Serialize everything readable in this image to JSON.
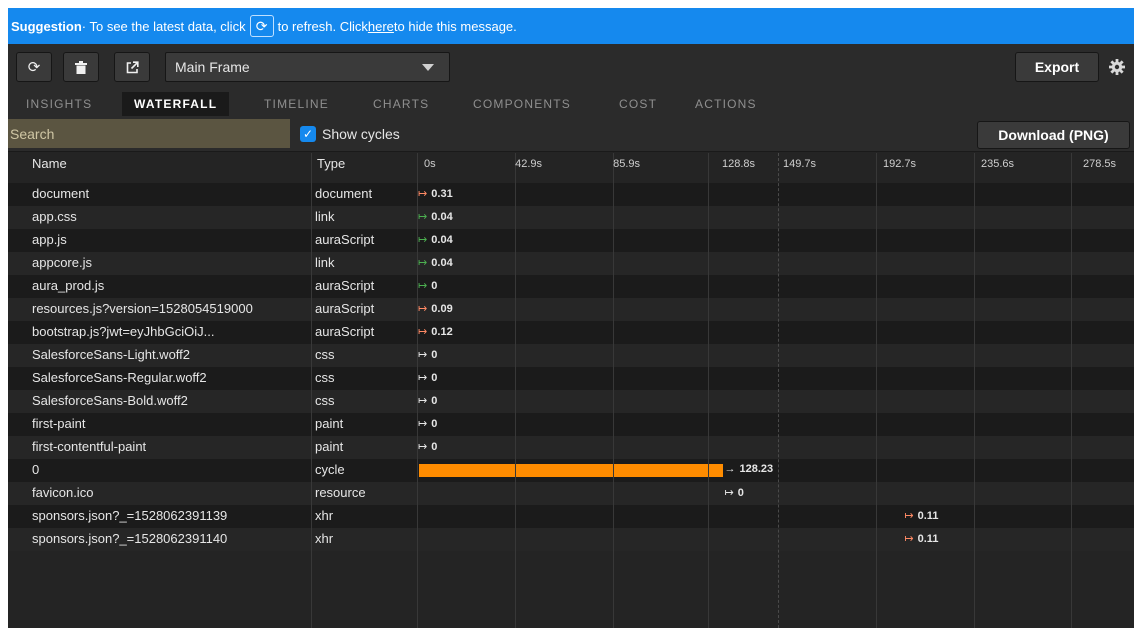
{
  "banner": {
    "title": "Suggestion",
    "text_before": " · To see the latest data, click ",
    "refresh_glyph": "⟳",
    "text_middle": " to refresh. Click ",
    "link_text": "here",
    "text_after": " to hide this message."
  },
  "toolbar": {
    "refresh_icon": "⟳",
    "trash_icon": "🗑",
    "popout_icon": "⧉",
    "frame_select_value": "Main Frame",
    "export_label": "Export"
  },
  "tabs": [
    {
      "label": "INSIGHTS",
      "active": false
    },
    {
      "label": "WATERFALL",
      "active": true
    },
    {
      "label": "TIMELINE",
      "active": false
    },
    {
      "label": "CHARTS",
      "active": false
    },
    {
      "label": "COMPONENTS",
      "active": false
    },
    {
      "label": "COST",
      "active": false
    },
    {
      "label": "ACTIONS",
      "active": false
    }
  ],
  "filter": {
    "search_placeholder": "Search",
    "show_cycles_label": "Show cycles",
    "show_cycles_checked": true,
    "download_label": "Download (PNG)"
  },
  "table": {
    "columns": {
      "name": "Name",
      "type": "Type"
    },
    "timeline_max": 300,
    "ticks": [
      "0s",
      "42.9s",
      "85.9s",
      "128.8s",
      "149.7s",
      "192.7s",
      "235.6s",
      "278.5s"
    ],
    "rows": [
      {
        "name": "document",
        "type": "document",
        "start": 0,
        "value": "0.31",
        "arrow_color": "#ff8a65"
      },
      {
        "name": "app.css",
        "type": "link",
        "start": 0,
        "value": "0.04",
        "arrow_color": "#4caf50"
      },
      {
        "name": "app.js",
        "type": "auraScript",
        "start": 0,
        "value": "0.04",
        "arrow_color": "#4caf50"
      },
      {
        "name": "appcore.js",
        "type": "link",
        "start": 0,
        "value": "0.04",
        "arrow_color": "#4caf50"
      },
      {
        "name": "aura_prod.js",
        "type": "auraScript",
        "start": 0,
        "value": "0",
        "arrow_color": "#4caf50"
      },
      {
        "name": "resources.js?version=1528054519000",
        "type": "auraScript",
        "start": 0,
        "value": "0.09",
        "arrow_color": "#ff8a65"
      },
      {
        "name": "bootstrap.js?jwt=eyJhbGciOiJ...",
        "type": "auraScript",
        "start": 0,
        "value": "0.12",
        "arrow_color": "#ff8a65"
      },
      {
        "name": "SalesforceSans-Light.woff2",
        "type": "css",
        "start": 0,
        "value": "0",
        "arrow_color": "#e6e6e6"
      },
      {
        "name": "SalesforceSans-Regular.woff2",
        "type": "css",
        "start": 0,
        "value": "0",
        "arrow_color": "#e6e6e6"
      },
      {
        "name": "SalesforceSans-Bold.woff2",
        "type": "css",
        "start": 0,
        "value": "0",
        "arrow_color": "#e6e6e6"
      },
      {
        "name": "first-paint",
        "type": "paint",
        "start": 0,
        "value": "0",
        "arrow_color": "#e6e6e6"
      },
      {
        "name": "first-contentful-paint",
        "type": "paint",
        "start": 0,
        "value": "0",
        "arrow_color": "#e6e6e6"
      },
      {
        "name": "0",
        "type": "cycle",
        "start": 0,
        "value": "128.23",
        "arrow_color": "#e6e6e6",
        "bar": true
      },
      {
        "name": "favicon.ico",
        "type": "resource",
        "start": 128.23,
        "value": "0",
        "arrow_color": "#e6e6e6"
      },
      {
        "name": "sponsors.json?_=1528062391139",
        "type": "xhr",
        "start": 203.5,
        "value": "0.11",
        "arrow_color": "#ff8a65"
      },
      {
        "name": "sponsors.json?_=1528062391140",
        "type": "xhr",
        "start": 203.5,
        "value": "0.11",
        "arrow_color": "#ff8a65"
      }
    ]
  },
  "colors": {
    "banner": "#1589ee",
    "cycle_bar": "#ff8c00",
    "panel_bg": "#242424"
  }
}
